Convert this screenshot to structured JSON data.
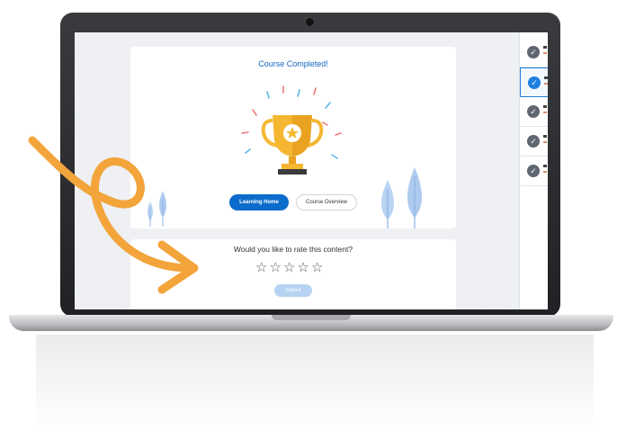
{
  "course": {
    "title": "Course Completed!",
    "learning_home_label": "Learning Home",
    "course_overview_label": "Course Overview"
  },
  "rating": {
    "question": "Would you like to rate this content?",
    "stars": [
      "☆",
      "☆",
      "☆",
      "☆",
      "☆"
    ],
    "rating_value": 0,
    "submit_label": "Submit"
  },
  "sidebar": {
    "items": [
      {
        "status": "completed",
        "active": false
      },
      {
        "status": "completed",
        "active": true
      },
      {
        "status": "completed",
        "active": false
      },
      {
        "status": "completed",
        "active": false
      },
      {
        "status": "completed",
        "active": false
      }
    ]
  },
  "colors": {
    "accent": "#0b6ccb",
    "title": "#1565c0",
    "trophy": "#f5b731",
    "arrow": "#f3a43a",
    "tree": "#aecbef"
  },
  "icons": {
    "trophy": "trophy-icon",
    "star": "star-outline-icon",
    "check": "check-circle-icon",
    "arrow": "curved-arrow-decoration"
  }
}
